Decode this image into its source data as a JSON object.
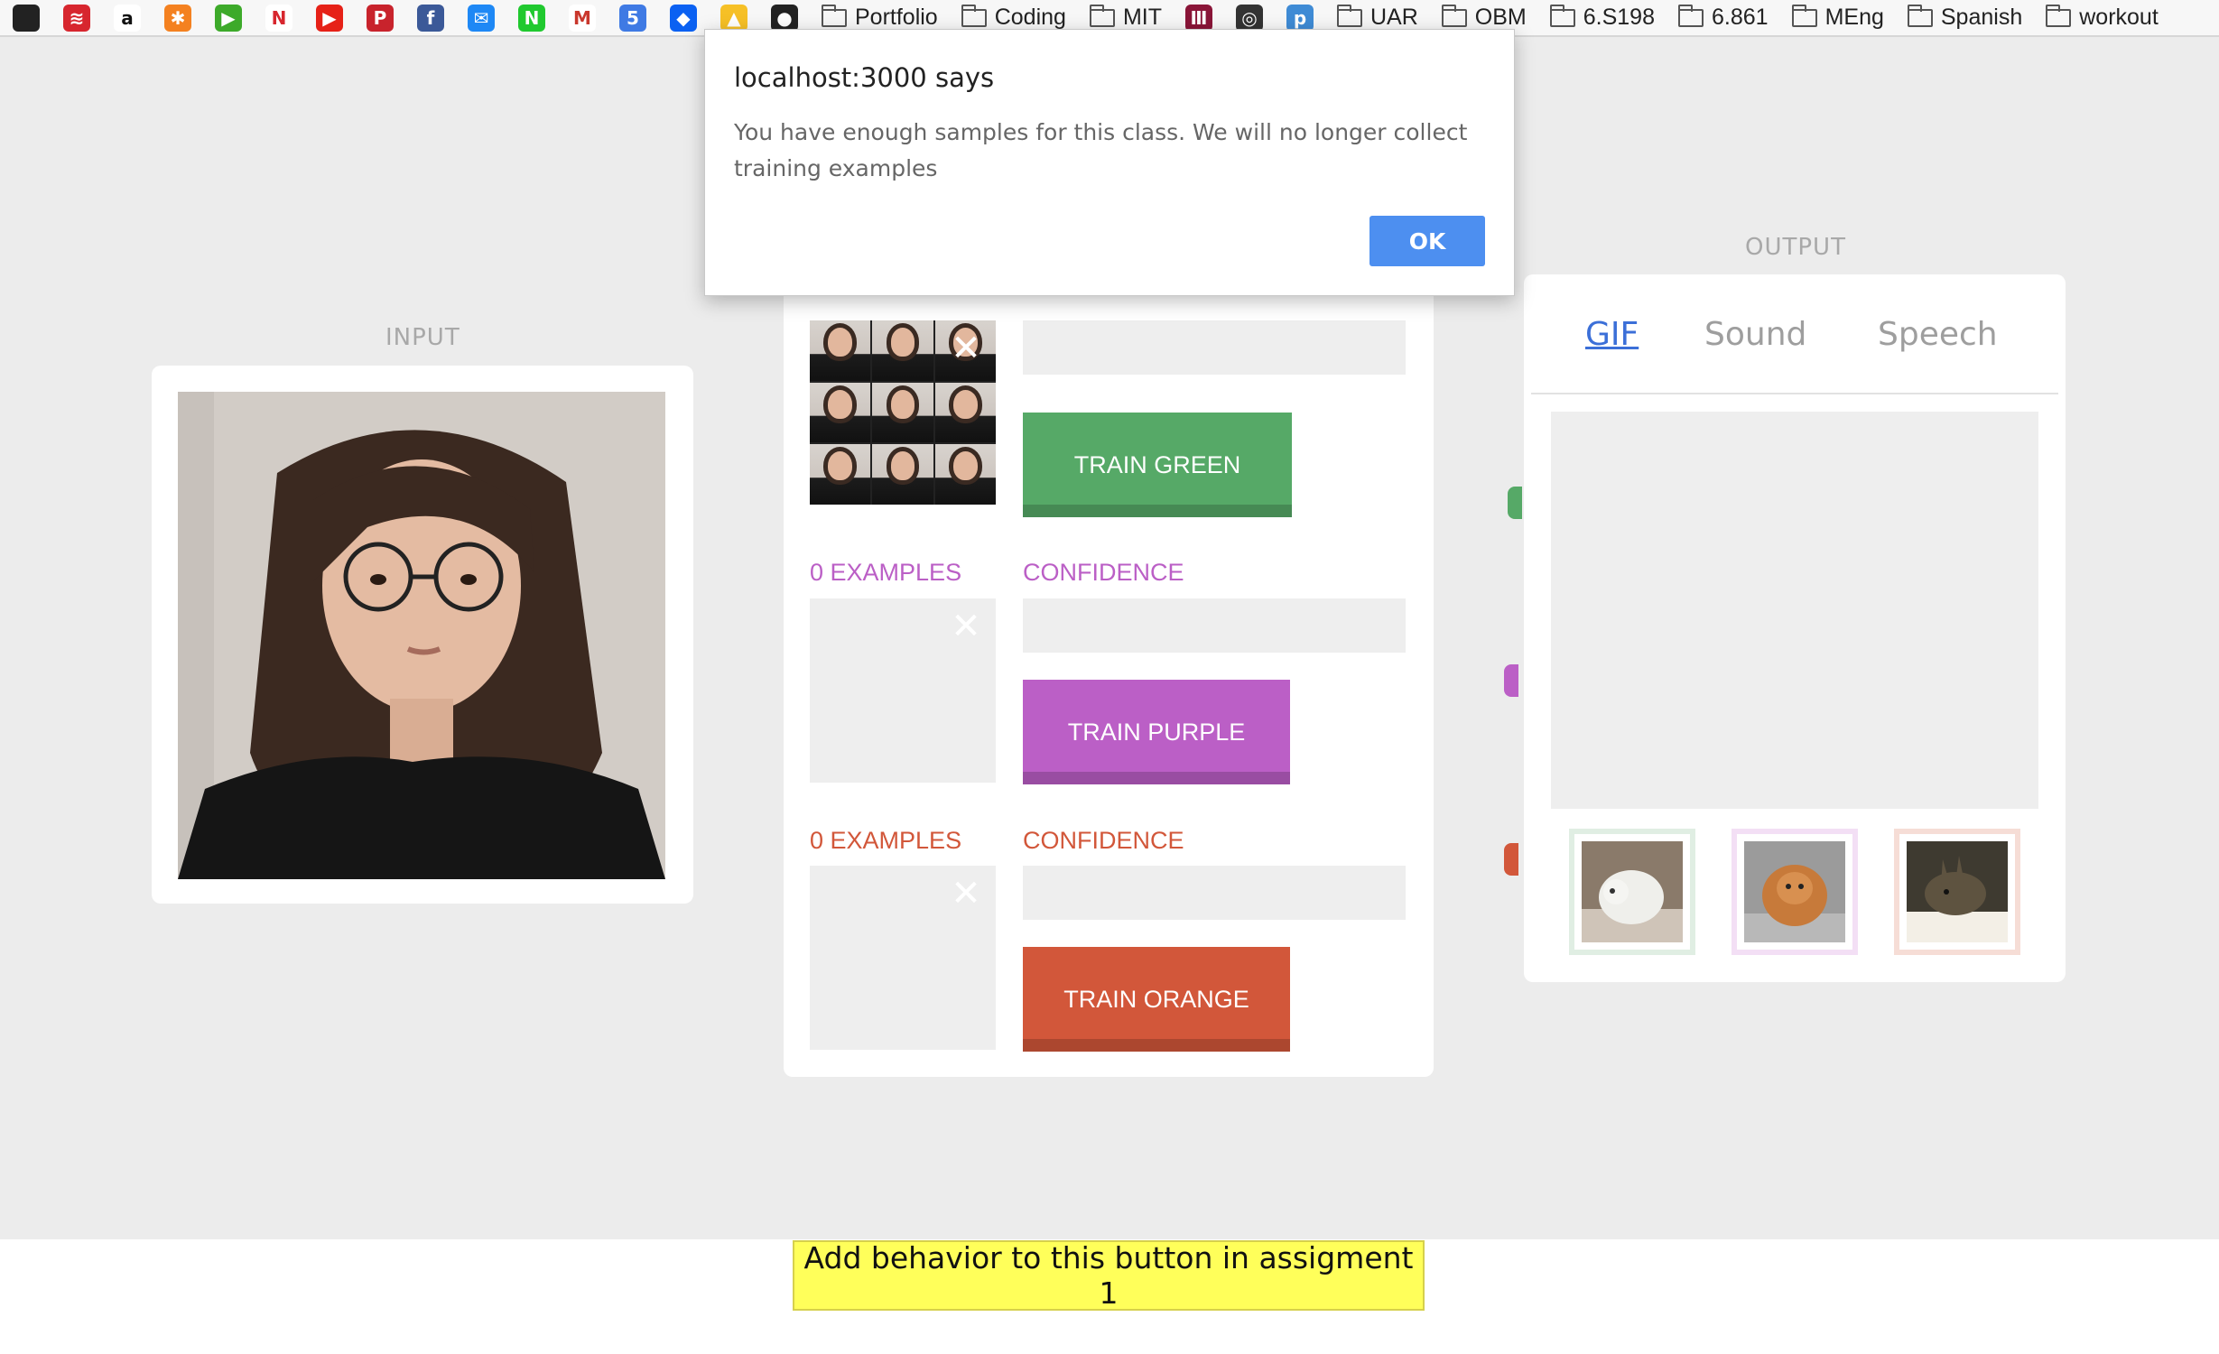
{
  "bookmarks_bar": {
    "icons": [
      {
        "name": "verizon-icon",
        "glyph": "",
        "bg": "#222222"
      },
      {
        "name": "bank-of-america-icon",
        "glyph": "≋",
        "bg": "#d7262e"
      },
      {
        "name": "amazon-icon",
        "glyph": "a",
        "bg": "#ffffff"
      },
      {
        "name": "slice-icon",
        "glyph": "✱",
        "bg": "#f48120"
      },
      {
        "name": "play-icon",
        "glyph": "▶",
        "bg": "#3daa2a"
      },
      {
        "name": "netflix-icon",
        "glyph": "N",
        "bg": "#ffffff"
      },
      {
        "name": "youtube-icon",
        "glyph": "▶",
        "bg": "#e62117"
      },
      {
        "name": "pinterest-icon",
        "glyph": "P",
        "bg": "#c8232c"
      },
      {
        "name": "facebook-icon",
        "glyph": "f",
        "bg": "#3b5998"
      },
      {
        "name": "messenger-icon",
        "glyph": "✉",
        "bg": "#1e88f5"
      },
      {
        "name": "naver-icon",
        "glyph": "N",
        "bg": "#20c92f"
      },
      {
        "name": "gmail-icon",
        "glyph": "M",
        "bg": "#ffffff"
      },
      {
        "name": "calendar-icon",
        "glyph": "5",
        "bg": "#3f7ae4"
      },
      {
        "name": "dropbox-icon",
        "glyph": "◆",
        "bg": "#0b61f2"
      },
      {
        "name": "google-drive-icon",
        "glyph": "▲",
        "bg": "#f6c026"
      },
      {
        "name": "github-icon",
        "glyph": "●",
        "bg": "#222222"
      }
    ],
    "folders_a": [
      "Portfolio",
      "Coding",
      "MIT"
    ],
    "icons_b": [
      {
        "name": "mit-logo-icon",
        "glyph": "Ⅲ",
        "bg": "#8a1538"
      },
      {
        "name": "ring-icon",
        "glyph": "◎",
        "bg": "#333333"
      },
      {
        "name": "p-app-icon",
        "glyph": "p",
        "bg": "#3f8bd5"
      }
    ],
    "folders_b": [
      "UAR",
      "OBM",
      "6.S198",
      "6.861",
      "MEng",
      "Spanish",
      "workout"
    ]
  },
  "input": {
    "label": "INPUT"
  },
  "training": {
    "classes": [
      {
        "color_name": "green",
        "examples_label": "",
        "confidence_label": "",
        "train_label": "TRAIN GREEN",
        "color": "#56a967",
        "text_color": "#56a967"
      },
      {
        "color_name": "purple",
        "examples_label": "0 EXAMPLES",
        "confidence_label": "CONFIDENCE",
        "train_label": "TRAIN PURPLE",
        "color": "#bb5fc6",
        "text_color": "#bb5fc6"
      },
      {
        "color_name": "orange",
        "examples_label": "0 EXAMPLES",
        "confidence_label": "CONFIDENCE",
        "train_label": "TRAIN ORANGE",
        "color": "#d2573a",
        "text_color": "#d2573a"
      }
    ],
    "clear_glyph": "✕"
  },
  "output": {
    "label": "OUTPUT",
    "tabs": [
      {
        "label": "GIF",
        "active": true
      },
      {
        "label": "Sound",
        "active": false
      },
      {
        "label": "Speech",
        "active": false
      }
    ],
    "gif_thumbs": [
      {
        "name": "gif-thumb-green",
        "border": "#e0eee3"
      },
      {
        "name": "gif-thumb-purple",
        "border": "#f3dff5"
      },
      {
        "name": "gif-thumb-orange",
        "border": "#f6ddd6"
      }
    ]
  },
  "footer": {
    "assignment_button": "Add behavior to this button in assigment 1"
  },
  "alert": {
    "title": "localhost:3000 says",
    "message": "You have enough samples for this class. We will no longer collect training examples",
    "ok_label": "OK"
  }
}
